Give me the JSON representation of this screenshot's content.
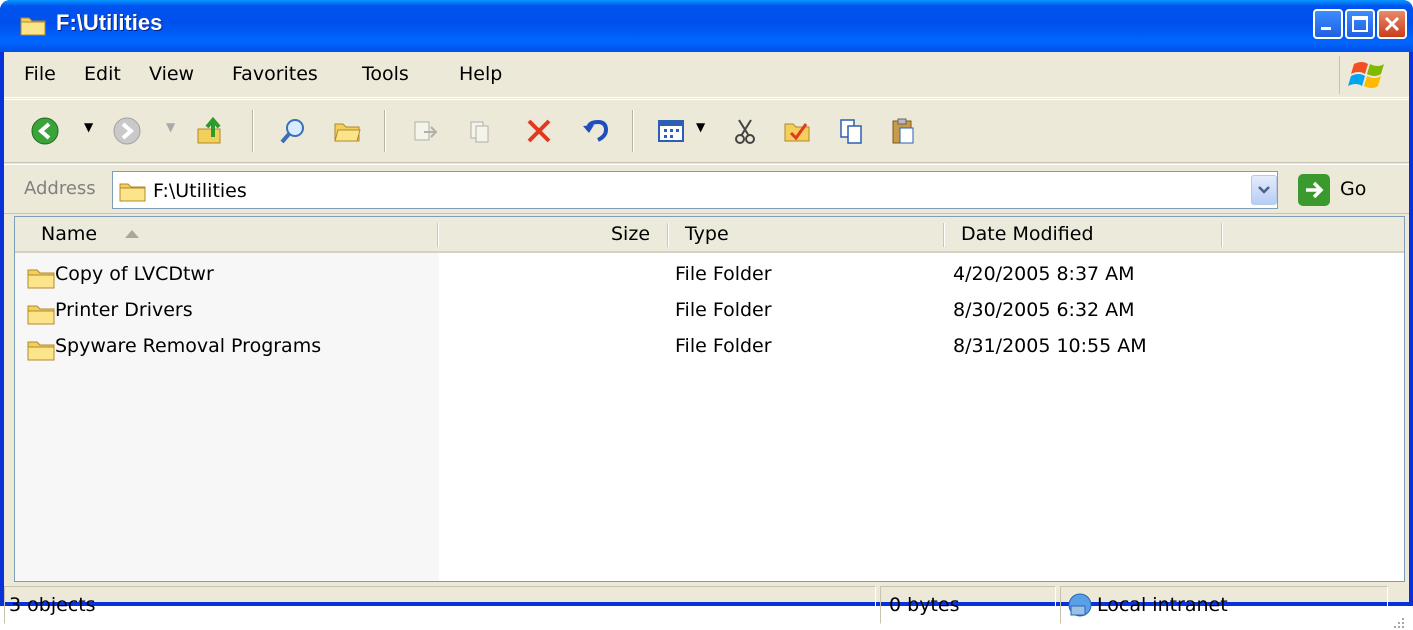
{
  "window": {
    "title": "F:\\Utilities",
    "icon": "folder-icon",
    "controls": [
      "minimize-icon",
      "maximize-icon",
      "close-icon"
    ]
  },
  "menu": [
    "File",
    "Edit",
    "View",
    "Favorites",
    "Tools",
    "Help"
  ],
  "toolbar": {
    "buttons": [
      "back-icon",
      "forward-icon",
      "up-folder-icon",
      "search-icon",
      "folders-icon",
      "move-to-icon",
      "copy-to-icon",
      "delete-icon",
      "undo-icon",
      "views-icon",
      "cut-icon",
      "properties-icon",
      "copy-icon",
      "paste-icon"
    ]
  },
  "address": {
    "label": "Address",
    "value": "F:\\Utilities",
    "go_label": "Go"
  },
  "columns": {
    "name": "Name",
    "size": "Size",
    "type": "Type",
    "date": "Date Modified"
  },
  "files": [
    {
      "name": "Copy of LVCDtwr",
      "size": "",
      "type": "File Folder",
      "date": "4/20/2005 8:37 AM"
    },
    {
      "name": "Printer Drivers",
      "size": "",
      "type": "File Folder",
      "date": "8/30/2005 6:32 AM"
    },
    {
      "name": "Spyware Removal Programs",
      "size": "",
      "type": "File Folder",
      "date": "8/31/2005 10:55 AM"
    }
  ],
  "status": {
    "objects": "3 objects",
    "size": "0 bytes",
    "zone": "Local intranet"
  },
  "colors": {
    "titlebar": "#0058ee",
    "frame": "#ece9d8",
    "folder": "#f5d46a"
  }
}
